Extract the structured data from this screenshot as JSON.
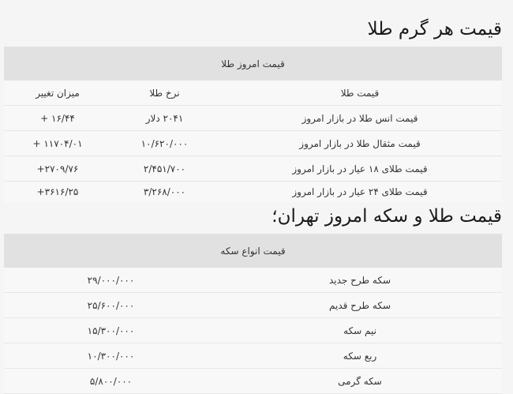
{
  "gram_section": {
    "title": "قیمت هر گرم طلا",
    "table_caption": "قیمت امروز طلا",
    "headers": [
      "قیمت طلا",
      "نرخ طلا",
      "میزان تغییر"
    ],
    "rows": [
      [
        "قیمت انس طلا در بازار امروز",
        "۲۰۴۱ دلار",
        "+ ۱۶/۴۴"
      ],
      [
        "قیمت مثقال طلا در بازار امروز",
        "۱۰/۶۲۰/۰۰۰",
        "+ ۱۱۷۰۴/۰۱"
      ],
      [
        "قیمت طلای ۱۸ عیار در بازار امروز",
        "۲/۴۵۱/۷۰۰",
        "+۲۷۰۹/۷۶"
      ],
      [
        "قیمت طلای ۲۴ عیار در بازار امروز",
        "۳/۲۶۸/۰۰۰",
        "+۳۶۱۶/۲۵"
      ]
    ]
  },
  "coin_section": {
    "title": "قیمت طلا و سکه امروز تهران؛",
    "table_caption": "قیمت انواع سکه",
    "rows": [
      [
        "سکه طرح جدید",
        "۲۹/۰۰۰/۰۰۰"
      ],
      [
        "سکه طرح قدیم",
        "۲۵/۶۰۰/۰۰۰"
      ],
      [
        "نیم سکه",
        "۱۵/۳۰۰/۰۰۰"
      ],
      [
        "ربع سکه",
        "۱۰/۳۰۰/۰۰۰"
      ],
      [
        "سکه گرمی",
        "۵/۸۰۰/۰۰۰"
      ]
    ]
  }
}
